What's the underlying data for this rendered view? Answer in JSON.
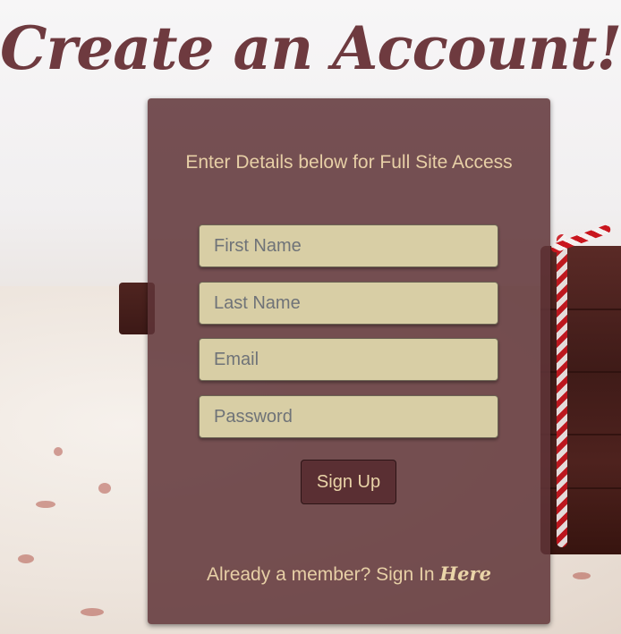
{
  "page": {
    "title": "Create an Account!"
  },
  "form": {
    "intro": "Enter Details below for Full Site Access",
    "fields": [
      {
        "placeholder": "First Name",
        "value": ""
      },
      {
        "placeholder": "Last Name",
        "value": ""
      },
      {
        "placeholder": "Email",
        "value": ""
      },
      {
        "placeholder": "Password",
        "value": ""
      }
    ],
    "submit_label": "Sign Up",
    "footer_text": "Already a member? Sign In ",
    "footer_link": "Here"
  },
  "colors": {
    "title": "#6e3a3f",
    "card": "#603438",
    "text": "#e7cfa6",
    "field": "#d8cea5",
    "button": "#5a2f33"
  }
}
